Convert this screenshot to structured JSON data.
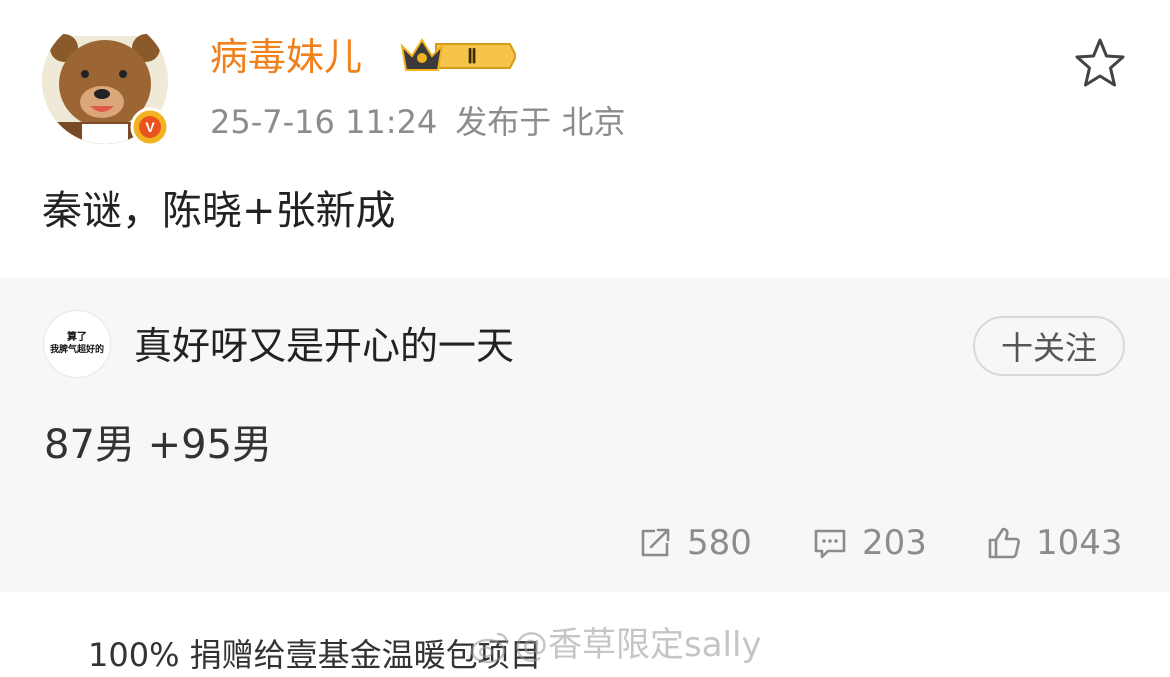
{
  "post": {
    "username": "病毒妹儿",
    "membership_level": "Ⅱ",
    "timestamp": "25-7-16 11:24",
    "published_from": "发布于 北京",
    "verified_badge": "V",
    "text": "秦谜，陈晓+张新成"
  },
  "repost": {
    "avatar_text_line1": "算了",
    "avatar_text_line2": "我脾气超好的",
    "username": "真好呀又是开心的一天",
    "follow_label": "十关注",
    "text": "87男 +95男",
    "stats": {
      "reposts": "580",
      "comments": "203",
      "likes": "1043"
    }
  },
  "footer": {
    "text": "100% 捐赠给壹基金温暖包项目",
    "watermark": "@香草限定sally"
  },
  "colors": {
    "username": "#f0811c",
    "meta": "#8c8c8c",
    "repost_bg": "#f7f7f7",
    "badge": "#f3b21f"
  },
  "icons": {
    "favorite": "star-icon",
    "repost": "share-icon",
    "comment": "comment-icon",
    "like": "thumbs-up-icon"
  }
}
